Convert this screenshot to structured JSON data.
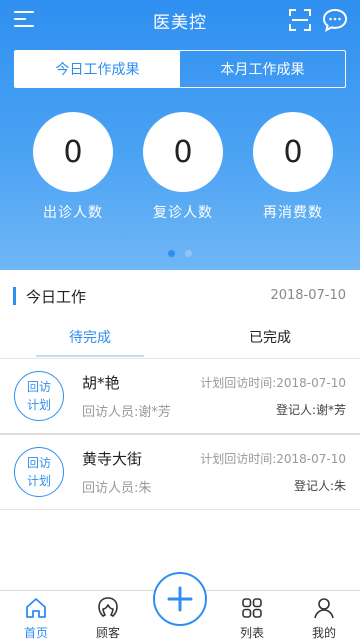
{
  "header": {
    "title": "医美控",
    "menu_icon": "menu-icon",
    "scan_icon": "scan-icon",
    "chat_icon": "chat-icon"
  },
  "toggle": {
    "today_label": "今日工作成果",
    "month_label": "本月工作成果",
    "selected": "today"
  },
  "stats": [
    {
      "value": "0",
      "label": "出诊人数"
    },
    {
      "value": "0",
      "label": "复诊人数"
    },
    {
      "value": "0",
      "label": "再消费数"
    }
  ],
  "pager": {
    "pages": 2,
    "current": 1
  },
  "today_work": {
    "title": "今日工作",
    "date": "2018-07-10",
    "tabs": {
      "pending": "待完成",
      "done": "已完成"
    },
    "items": [
      {
        "badge_line1": "回访",
        "badge_line2": "计划",
        "name": "胡*艳",
        "planned_time": "计划回访时间:2018-07-10",
        "visitor": "回访人员:谢*芳",
        "registrar": "登记人:谢*芳"
      },
      {
        "badge_line1": "回访",
        "badge_line2": "计划",
        "name": "黄寺大街",
        "planned_time": "计划回访时间:2018-07-10",
        "visitor": "回访人员:朱",
        "registrar": "登记人:朱"
      }
    ]
  },
  "tabbar": {
    "items": [
      {
        "label": "首页",
        "icon": "home-icon"
      },
      {
        "label": "顾客",
        "icon": "customer-icon"
      },
      {
        "label": "列表",
        "icon": "grid-icon"
      },
      {
        "label": "我的",
        "icon": "person-icon"
      }
    ],
    "add_icon": "plus-icon"
  },
  "colors": {
    "accent": "#2f8ff0",
    "hero_top": "#2f8ff0",
    "hero_bottom": "#6fb6f5"
  }
}
